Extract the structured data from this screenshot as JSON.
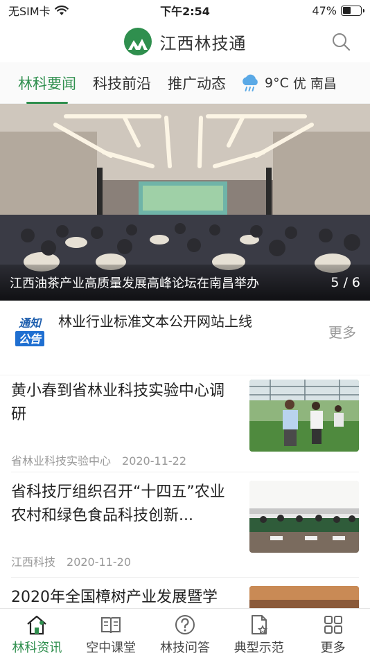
{
  "status_bar": {
    "carrier": "无SIM卡",
    "time": "下午2:54",
    "battery": "47%",
    "battery_level": 0.47
  },
  "app": {
    "title": "江西林技通"
  },
  "tabs": [
    {
      "label": "林科要闻",
      "active": true
    },
    {
      "label": "科技前沿"
    },
    {
      "label": "推广动态"
    }
  ],
  "weather": {
    "temp": "9°C",
    "quality": "优",
    "city": "南昌",
    "icon": "rain-cloud-icon"
  },
  "banner": {
    "caption": "江西油茶产业高质量发展高峰论坛在南昌举办",
    "index": "5 / 6"
  },
  "notice": {
    "badge_line1": "通知",
    "badge_line2": "公告",
    "text": "林业行业标准文本公开网站上线",
    "more": "更多"
  },
  "news": [
    {
      "title": "黄小春到省林业科技实验中心调研",
      "source": "省林业科技实验中心",
      "date": "2020-11-22"
    },
    {
      "title": "省科技厅组织召开“十四五”农业农村和绿色食品科技创新...",
      "source": "江西科技",
      "date": "2020-11-20"
    },
    {
      "title": "2020年全国樟树产业发展暨学",
      "source": "",
      "date": ""
    }
  ],
  "tabbar": [
    {
      "label": "林科资讯",
      "icon": "home-icon",
      "active": true
    },
    {
      "label": "空中课堂",
      "icon": "book-icon"
    },
    {
      "label": "林技问答",
      "icon": "question-icon"
    },
    {
      "label": "典型示范",
      "icon": "document-star-icon"
    },
    {
      "label": "更多",
      "icon": "grid-icon"
    }
  ],
  "colors": {
    "accent": "#2f8f4e"
  }
}
